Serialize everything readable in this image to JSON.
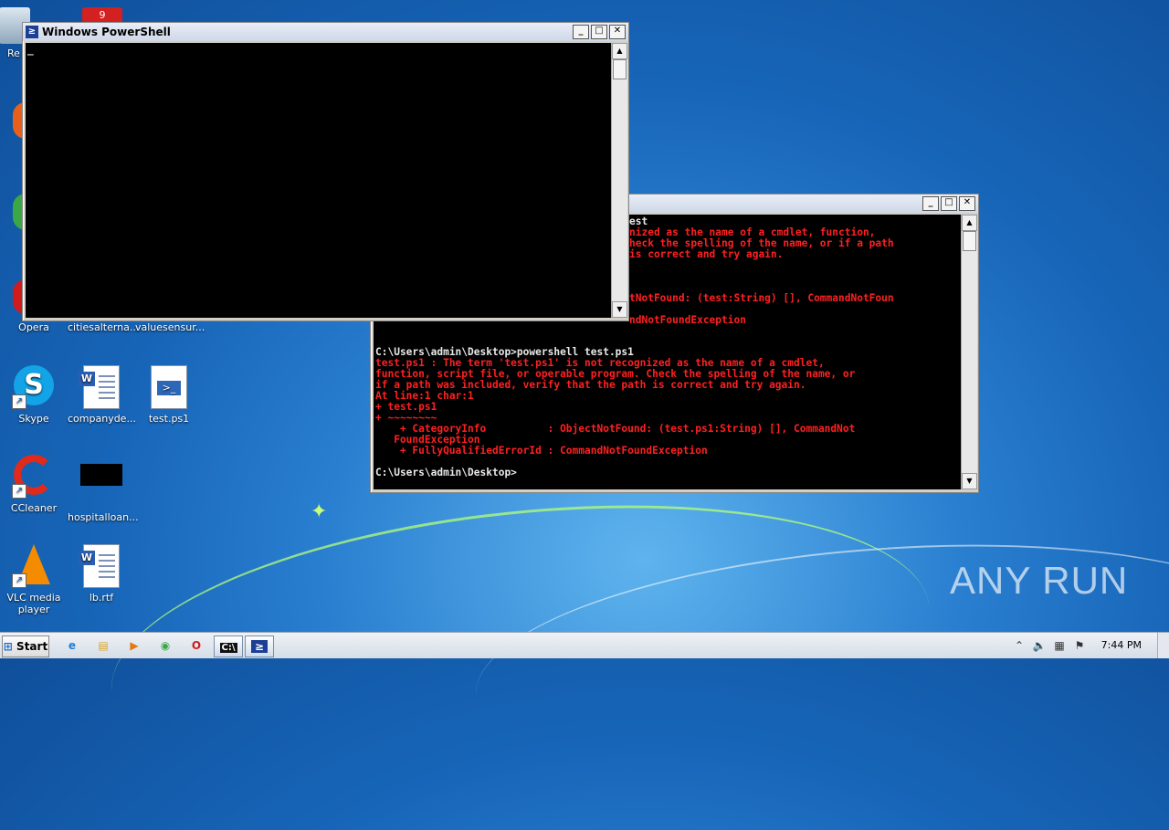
{
  "desktop": {
    "partial_labels": [
      "Re"
    ],
    "icons": [
      {
        "label": "Opera",
        "icon": "opera-icon"
      },
      {
        "label": "citiesalterna...",
        "icon": "word-doc-icon"
      },
      {
        "label": "valuesensur...",
        "icon": "word-doc-icon"
      },
      {
        "label": "Skype",
        "icon": "skype-icon"
      },
      {
        "label": "companyde...",
        "icon": "word-doc-icon"
      },
      {
        "label": "test.ps1",
        "icon": "powershell-script-icon"
      },
      {
        "label": "CCleaner",
        "icon": "ccleaner-icon"
      },
      {
        "label": "hospitalloan...",
        "icon": "black-file-icon"
      },
      {
        "label": "VLC media player",
        "icon": "vlc-icon"
      },
      {
        "label": "lb.rtf",
        "icon": "word-doc-icon"
      }
    ],
    "badge_count": "9"
  },
  "powershell_window": {
    "title": "Windows PowerShell",
    "cursor": "_"
  },
  "cmd_window": {
    "lines": [
      {
        "text": "est",
        "color": "w"
      },
      {
        "text": "nized as the name of a cmdlet, function,",
        "color": "r"
      },
      {
        "text": "heck the spelling of the name, or if a path",
        "color": "r"
      },
      {
        "text": "is correct and try again.",
        "color": "r"
      },
      {
        "text": "",
        "color": "r"
      },
      {
        "text": "",
        "color": "r"
      },
      {
        "text": "",
        "color": "r"
      },
      {
        "text": "tNotFound: (test:String) [], CommandNotFoun",
        "color": "r"
      },
      {
        "text": "",
        "color": "r"
      },
      {
        "text": "ndNotFoundException",
        "color": "r"
      }
    ],
    "main_lines": [
      {
        "text": "C:\\Users\\admin\\Desktop>powershell test.ps1",
        "color": "w"
      },
      {
        "text": "test.ps1 : The term 'test.ps1' is not recognized as the name of a cmdlet,",
        "color": "r"
      },
      {
        "text": "function, script file, or operable program. Check the spelling of the name, or",
        "color": "r"
      },
      {
        "text": "if a path was included, verify that the path is correct and try again.",
        "color": "r"
      },
      {
        "text": "At line:1 char:1",
        "color": "r"
      },
      {
        "text": "+ test.ps1",
        "color": "r"
      },
      {
        "text": "+ ~~~~~~~~",
        "color": "r"
      },
      {
        "text": "    + CategoryInfo          : ObjectNotFound: (test.ps1:String) [], CommandNot",
        "color": "r"
      },
      {
        "text": "   FoundException",
        "color": "r"
      },
      {
        "text": "    + FullyQualifiedErrorId : CommandNotFoundException",
        "color": "r"
      },
      {
        "text": "",
        "color": "r"
      },
      {
        "text": "C:\\Users\\admin\\Desktop>",
        "color": "w"
      }
    ]
  },
  "window_controls": {
    "minimize": "_",
    "maximize": "□",
    "close": "✕"
  },
  "taskbar": {
    "start_label": "Start",
    "clock": "7:44 PM",
    "pinned": [
      {
        "name": "ie-icon",
        "glyph": "e"
      },
      {
        "name": "explorer-icon",
        "glyph": "▤"
      },
      {
        "name": "media-player-icon",
        "glyph": "▶"
      },
      {
        "name": "chrome-icon",
        "glyph": "◉"
      },
      {
        "name": "opera-icon",
        "glyph": "O"
      },
      {
        "name": "cmd-icon",
        "glyph": "C:\\"
      },
      {
        "name": "powershell-icon",
        "glyph": "≥"
      }
    ],
    "tray_icons": [
      "chevron-up-icon",
      "speaker-icon",
      "network-icon",
      "flag-icon"
    ]
  },
  "watermark": "ANY RUN"
}
